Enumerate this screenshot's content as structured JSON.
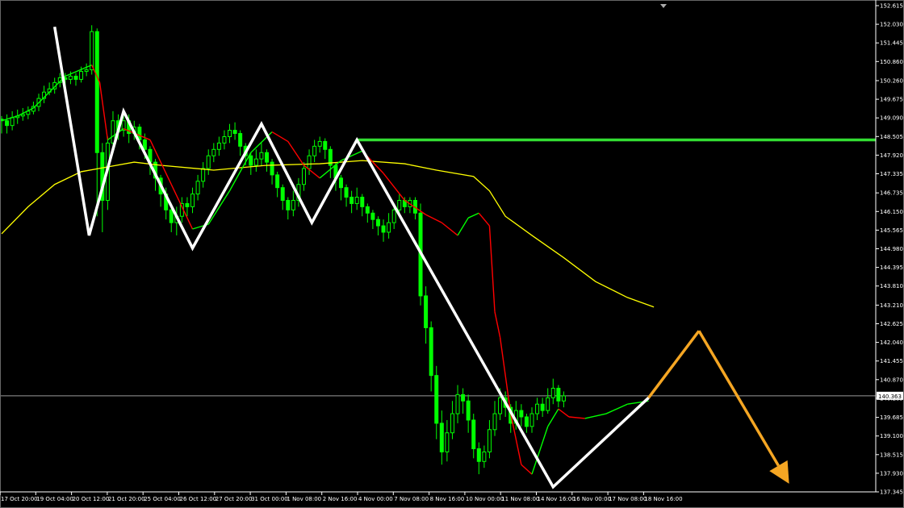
{
  "chart_data": {
    "type": "candlestick",
    "y_axis_ticks": [
      "152.615",
      "152.030",
      "151.445",
      "150.860",
      "150.260",
      "149.675",
      "149.090",
      "148.505",
      "147.920",
      "147.335",
      "146.735",
      "146.150",
      "145.565",
      "144.980",
      "144.395",
      "143.810",
      "143.210",
      "142.625",
      "142.040",
      "141.455",
      "140.870",
      "140.285",
      "139.685",
      "139.100",
      "138.515",
      "137.930",
      "137.345"
    ],
    "ylim": [
      137.345,
      152.615
    ],
    "x_axis_ticks": [
      "17 Oct 20:00",
      "19 Oct 04:00",
      "20 Oct 12:00",
      "21 Oct 20:00",
      "25 Oct 04:00",
      "26 Oct 12:00",
      "27 Oct 20:00",
      "31 Oct 00:00",
      "1 Nov 08:00",
      "2 Nov 16:00",
      "4 Nov 00:00",
      "7 Nov 08:00",
      "8 Nov 16:00",
      "10 Nov 00:00",
      "11 Nov 08:00",
      "14 Nov 16:00",
      "16 Nov 00:00",
      "17 Nov 08:00",
      "18 Nov 16:00"
    ],
    "current_price": "140.363",
    "resistance_level": 148.4,
    "colors": {
      "background": "#000000",
      "candle": "#00ff00",
      "fast_ma_up": "#00ff00",
      "fast_ma_down": "#ff0000",
      "slow_ma": "#ffff00",
      "resistance_line": "#33dd33",
      "pattern_line": "#ffffff",
      "projection": "#f5a623",
      "axis": "#ffffff",
      "price_line": "#9a9a9a"
    },
    "pattern_points": [
      {
        "x": 10,
        "y": 151.95
      },
      {
        "x": 16.5,
        "y": 145.4
      },
      {
        "x": 23,
        "y": 149.3
      },
      {
        "x": 36,
        "y": 145.0
      },
      {
        "x": 49,
        "y": 148.9
      },
      {
        "x": 58.5,
        "y": 145.8
      },
      {
        "x": 67,
        "y": 148.4
      },
      {
        "x": 104,
        "y": 137.5
      },
      {
        "x": 122,
        "y": 140.3
      }
    ],
    "projection_points": [
      {
        "x": 122,
        "y": 140.3
      },
      {
        "x": 131.5,
        "y": 142.4
      },
      {
        "x": 148.5,
        "y": 137.6
      }
    ],
    "slow_ma": [
      {
        "x": 0,
        "y": 145.45
      },
      {
        "x": 5,
        "y": 146.3
      },
      {
        "x": 10,
        "y": 147.0
      },
      {
        "x": 15,
        "y": 147.4
      },
      {
        "x": 20,
        "y": 147.55
      },
      {
        "x": 25,
        "y": 147.7
      },
      {
        "x": 30,
        "y": 147.6
      },
      {
        "x": 40,
        "y": 147.45
      },
      {
        "x": 50,
        "y": 147.6
      },
      {
        "x": 60,
        "y": 147.65
      },
      {
        "x": 68,
        "y": 147.75
      },
      {
        "x": 76,
        "y": 147.65
      },
      {
        "x": 82,
        "y": 147.45
      },
      {
        "x": 89,
        "y": 147.25
      },
      {
        "x": 92,
        "y": 146.8
      },
      {
        "x": 95,
        "y": 146.0
      },
      {
        "x": 100,
        "y": 145.4
      },
      {
        "x": 106,
        "y": 144.7
      },
      {
        "x": 112,
        "y": 143.95
      },
      {
        "x": 118,
        "y": 143.45
      },
      {
        "x": 123,
        "y": 143.15
      }
    ],
    "fast_ma": [
      {
        "x": 0,
        "y": 149.0
      },
      {
        "x": 3,
        "y": 149.15
      },
      {
        "x": 6,
        "y": 149.4
      },
      {
        "x": 9,
        "y": 149.9
      },
      {
        "x": 12,
        "y": 150.4
      },
      {
        "x": 17,
        "y": 150.75
      },
      {
        "x": 18.5,
        "y": 150.2
      },
      {
        "x": 20,
        "y": 148.4
      },
      {
        "x": 23,
        "y": 148.75
      },
      {
        "x": 28,
        "y": 148.4
      },
      {
        "x": 32,
        "y": 147.0
      },
      {
        "x": 36,
        "y": 145.6
      },
      {
        "x": 39,
        "y": 145.75
      },
      {
        "x": 43,
        "y": 146.8
      },
      {
        "x": 47,
        "y": 148.0
      },
      {
        "x": 51,
        "y": 148.65
      },
      {
        "x": 54,
        "y": 148.35
      },
      {
        "x": 57,
        "y": 147.6
      },
      {
        "x": 60,
        "y": 147.2
      },
      {
        "x": 64,
        "y": 147.75
      },
      {
        "x": 68,
        "y": 148.05
      },
      {
        "x": 72,
        "y": 147.35
      },
      {
        "x": 76,
        "y": 146.5
      },
      {
        "x": 80,
        "y": 146.05
      },
      {
        "x": 83,
        "y": 145.8
      },
      {
        "x": 86,
        "y": 145.4
      },
      {
        "x": 88,
        "y": 145.95
      },
      {
        "x": 90,
        "y": 146.1
      },
      {
        "x": 92,
        "y": 145.7
      },
      {
        "x": 93,
        "y": 143.0
      },
      {
        "x": 94,
        "y": 142.2
      },
      {
        "x": 96,
        "y": 139.8
      },
      {
        "x": 98,
        "y": 138.2
      },
      {
        "x": 100,
        "y": 137.9
      },
      {
        "x": 103,
        "y": 139.4
      },
      {
        "x": 105,
        "y": 139.95
      },
      {
        "x": 107,
        "y": 139.7
      },
      {
        "x": 110,
        "y": 139.65
      },
      {
        "x": 114,
        "y": 139.8
      },
      {
        "x": 118,
        "y": 140.1
      },
      {
        "x": 122,
        "y": 140.2
      }
    ],
    "candles_note": "",
    "candles": [
      [
        149.05,
        149.0,
        149.15,
        148.6
      ],
      [
        149.0,
        148.85,
        149.2,
        148.6
      ],
      [
        148.85,
        149.1,
        149.3,
        148.7
      ],
      [
        149.1,
        149.15,
        149.35,
        148.9
      ],
      [
        149.15,
        149.2,
        149.4,
        149.0
      ],
      [
        149.2,
        149.3,
        149.45,
        149.05
      ],
      [
        149.3,
        149.45,
        149.6,
        149.2
      ],
      [
        149.45,
        149.7,
        149.85,
        149.3
      ],
      [
        149.7,
        149.9,
        150.1,
        149.55
      ],
      [
        149.9,
        150.0,
        150.2,
        149.8
      ],
      [
        150.0,
        150.2,
        150.35,
        149.85
      ],
      [
        150.2,
        150.35,
        150.5,
        150.05
      ],
      [
        150.35,
        150.3,
        150.5,
        150.1
      ],
      [
        150.3,
        150.4,
        150.55,
        150.15
      ],
      [
        150.4,
        150.3,
        150.5,
        150.1
      ],
      [
        150.3,
        150.55,
        150.7,
        150.2
      ],
      [
        150.55,
        150.6,
        150.8,
        150.4
      ],
      [
        150.6,
        151.8,
        152.0,
        150.45
      ],
      [
        151.8,
        148.0,
        151.9,
        146.0
      ],
      [
        148.0,
        146.5,
        148.3,
        145.5
      ],
      [
        146.5,
        148.3,
        148.5,
        146.2
      ],
      [
        148.3,
        149.0,
        149.3,
        148.0
      ],
      [
        149.0,
        148.7,
        149.2,
        148.4
      ],
      [
        148.7,
        149.0,
        149.2,
        148.5
      ],
      [
        149.0,
        148.6,
        149.2,
        148.3
      ],
      [
        148.6,
        148.8,
        149.0,
        148.4
      ],
      [
        148.8,
        148.4,
        148.9,
        148.1
      ],
      [
        148.4,
        148.1,
        148.6,
        147.8
      ],
      [
        148.1,
        147.7,
        148.2,
        147.3
      ],
      [
        147.7,
        147.2,
        147.8,
        146.8
      ],
      [
        147.2,
        146.7,
        147.3,
        146.3
      ],
      [
        146.7,
        146.2,
        146.9,
        145.9
      ],
      [
        146.2,
        145.8,
        146.4,
        145.5
      ],
      [
        145.8,
        146.0,
        146.3,
        145.4
      ],
      [
        146.0,
        146.4,
        146.6,
        145.8
      ],
      [
        146.4,
        146.3,
        146.6,
        146.0
      ],
      [
        146.3,
        146.7,
        146.9,
        146.1
      ],
      [
        146.7,
        147.1,
        147.3,
        146.5
      ],
      [
        147.1,
        147.5,
        147.7,
        146.9
      ],
      [
        147.5,
        147.9,
        148.1,
        147.3
      ],
      [
        147.9,
        148.1,
        148.3,
        147.7
      ],
      [
        148.1,
        148.3,
        148.5,
        147.9
      ],
      [
        148.3,
        148.5,
        148.7,
        148.1
      ],
      [
        148.5,
        148.7,
        148.9,
        148.3
      ],
      [
        148.7,
        148.6,
        148.95,
        148.4
      ],
      [
        148.6,
        148.2,
        148.7,
        147.9
      ],
      [
        148.2,
        147.9,
        148.3,
        147.6
      ],
      [
        147.9,
        147.6,
        148.0,
        147.3
      ],
      [
        147.6,
        147.8,
        148.1,
        147.4
      ],
      [
        147.8,
        148.0,
        148.3,
        147.6
      ],
      [
        148.0,
        147.7,
        148.1,
        147.4
      ],
      [
        147.7,
        147.3,
        147.8,
        147.0
      ],
      [
        147.3,
        146.9,
        147.4,
        146.6
      ],
      [
        146.9,
        146.5,
        147.0,
        146.2
      ],
      [
        146.5,
        146.2,
        146.6,
        145.9
      ],
      [
        146.2,
        146.5,
        146.8,
        146.0
      ],
      [
        146.5,
        147.0,
        147.2,
        146.3
      ],
      [
        147.0,
        147.5,
        147.7,
        146.8
      ],
      [
        147.5,
        147.9,
        148.1,
        147.3
      ],
      [
        147.9,
        148.2,
        148.4,
        147.7
      ],
      [
        148.2,
        148.35,
        148.5,
        148.0
      ],
      [
        148.35,
        148.1,
        148.45,
        147.8
      ],
      [
        148.1,
        147.6,
        148.2,
        147.2
      ],
      [
        147.6,
        147.2,
        147.7,
        146.8
      ],
      [
        147.2,
        146.9,
        147.3,
        146.5
      ],
      [
        146.9,
        146.6,
        147.0,
        146.3
      ],
      [
        146.6,
        146.4,
        146.8,
        146.1
      ],
      [
        146.4,
        146.6,
        146.9,
        146.2
      ],
      [
        146.6,
        146.3,
        146.7,
        146.0
      ],
      [
        146.3,
        146.1,
        146.4,
        145.8
      ],
      [
        146.1,
        145.9,
        146.2,
        145.6
      ],
      [
        145.9,
        145.7,
        146.0,
        145.4
      ],
      [
        145.7,
        145.5,
        145.9,
        145.2
      ],
      [
        145.5,
        145.8,
        146.1,
        145.3
      ],
      [
        145.8,
        146.2,
        146.4,
        145.6
      ],
      [
        146.2,
        146.5,
        146.7,
        146.0
      ],
      [
        146.5,
        146.3,
        146.6,
        146.1
      ],
      [
        146.3,
        146.5,
        146.6,
        146.1
      ],
      [
        146.5,
        146.1,
        146.6,
        145.9
      ],
      [
        146.1,
        143.5,
        146.4,
        143.2
      ],
      [
        143.5,
        142.5,
        143.8,
        142.0
      ],
      [
        142.5,
        141.0,
        142.7,
        140.5
      ],
      [
        141.0,
        139.5,
        141.3,
        139.0
      ],
      [
        139.5,
        138.6,
        139.9,
        138.2
      ],
      [
        138.6,
        139.2,
        139.6,
        138.3
      ],
      [
        139.2,
        139.8,
        140.2,
        139.0
      ],
      [
        139.8,
        140.4,
        140.7,
        139.5
      ],
      [
        140.4,
        140.2,
        140.6,
        139.8
      ],
      [
        140.2,
        139.6,
        140.4,
        139.2
      ],
      [
        139.6,
        138.7,
        139.8,
        138.4
      ],
      [
        138.7,
        138.3,
        138.9,
        137.9
      ],
      [
        138.3,
        138.6,
        138.8,
        138.1
      ],
      [
        138.6,
        139.3,
        139.6,
        138.4
      ],
      [
        139.3,
        139.8,
        140.2,
        139.1
      ],
      [
        139.8,
        140.3,
        140.6,
        139.6
      ],
      [
        140.3,
        140.0,
        140.5,
        139.7
      ],
      [
        140.0,
        139.5,
        140.1,
        139.2
      ],
      [
        139.5,
        139.9,
        140.2,
        139.3
      ],
      [
        139.9,
        139.7,
        140.1,
        139.4
      ],
      [
        139.7,
        139.4,
        139.8,
        139.2
      ],
      [
        139.4,
        139.8,
        140.0,
        139.2
      ],
      [
        139.8,
        140.1,
        140.3,
        139.6
      ],
      [
        140.1,
        139.9,
        140.3,
        139.7
      ],
      [
        139.9,
        140.3,
        140.6,
        139.8
      ],
      [
        140.3,
        140.6,
        140.9,
        140.1
      ],
      [
        140.6,
        140.2,
        140.7,
        140.0
      ],
      [
        140.2,
        140.36,
        140.5,
        140.0
      ]
    ]
  }
}
